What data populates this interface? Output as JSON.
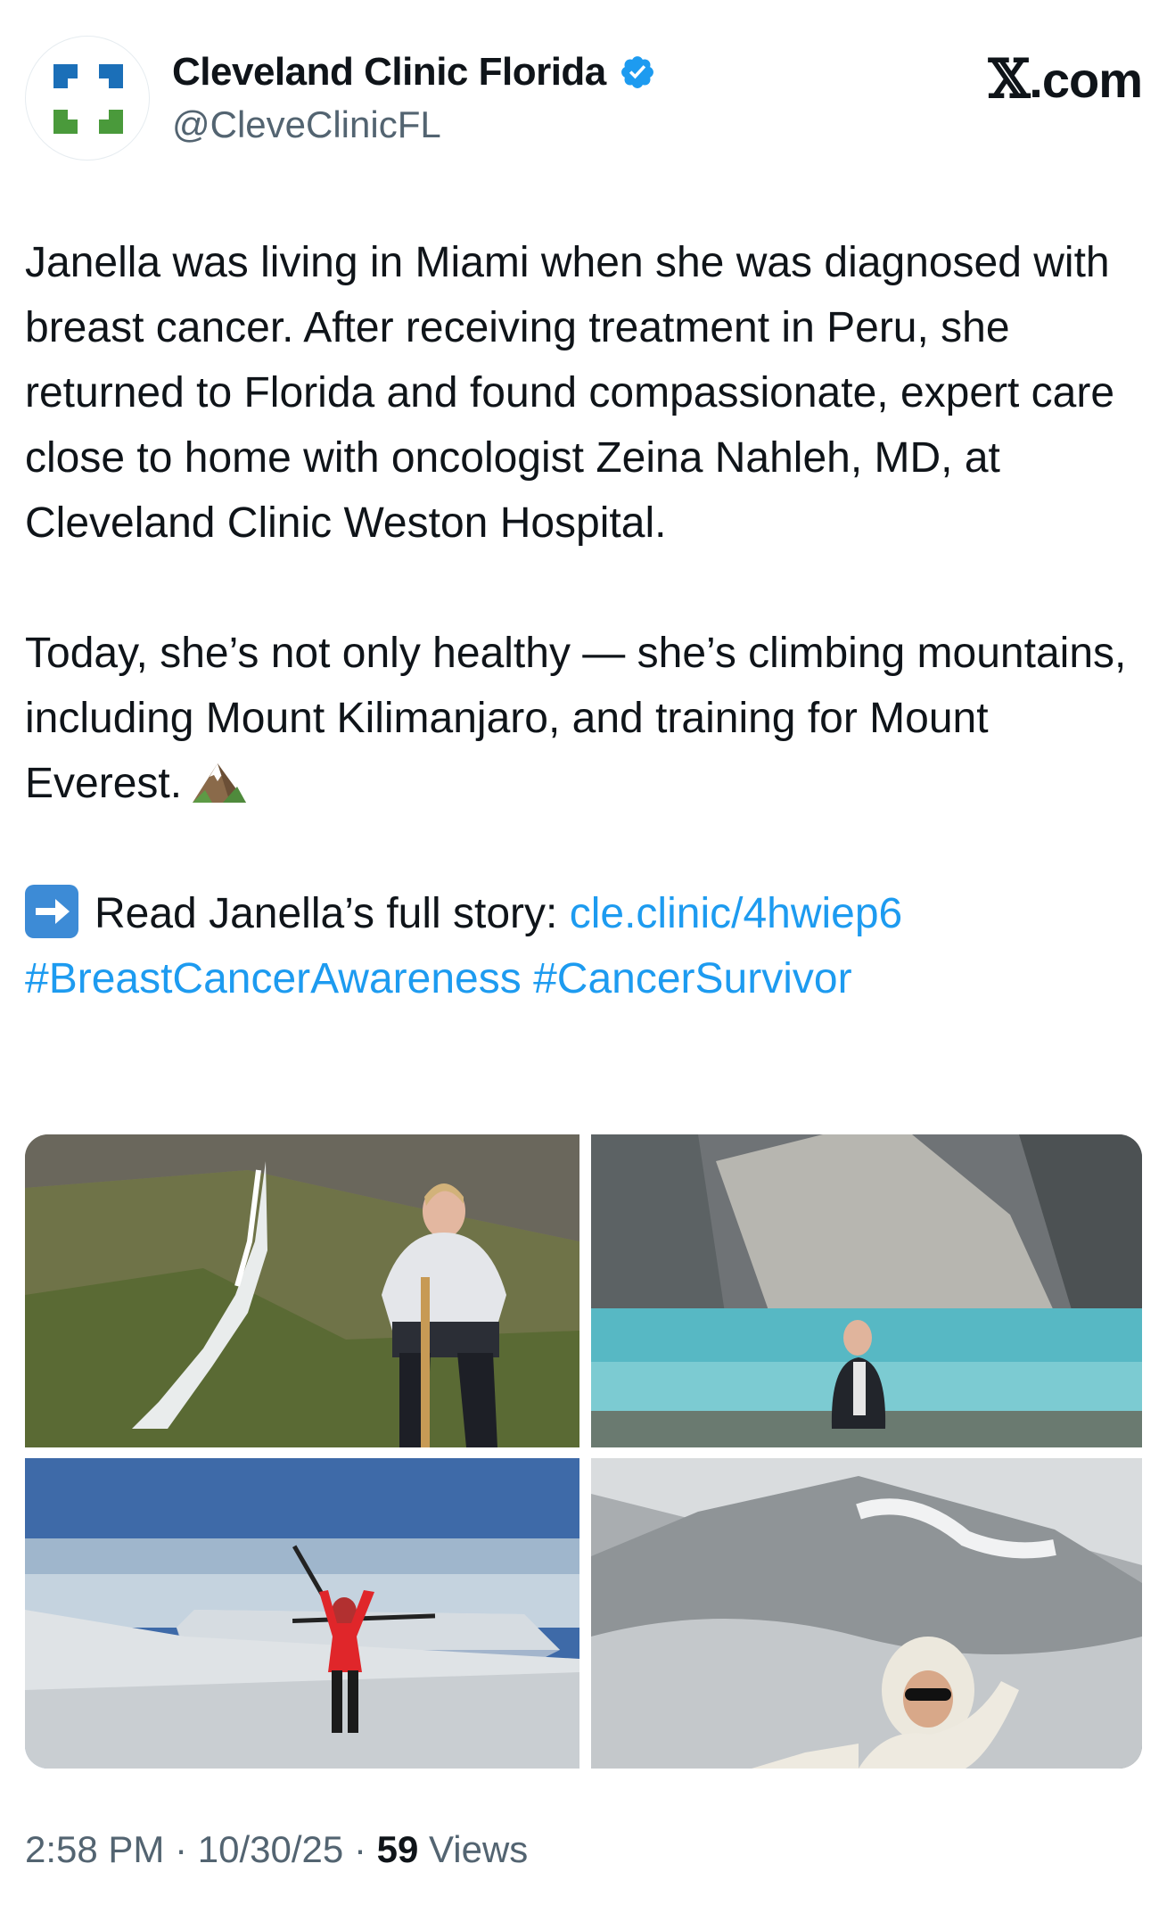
{
  "account": {
    "display_name": "Cleveland Clinic Florida",
    "handle": "@CleveClinicFL",
    "verified": true,
    "avatar_icon": "cleveland-clinic-logo-icon",
    "verified_icon": "verified-badge-icon"
  },
  "site_logo": {
    "mark": "𝕏",
    "text": ".com"
  },
  "tweet": {
    "paragraph1": "Janella was living in Miami when she was diagnosed with breast cancer. After receiving treatment in Peru, she returned to Florida and found compassionate, expert care close to home with oncologist Zeina Nahleh, MD, at Cleveland Clinic Weston Hospital.",
    "paragraph2": "Today, she’s not only healthy — she’s climbing mountains, including Mount Kilimanjaro, and training for Mount Everest.",
    "paragraph2_emoji": "snow-capped-mountain-emoji",
    "cta_emoji": "right-arrow-emoji",
    "cta_text": "Read Janella’s full story:",
    "link": "cle.clinic/4hwiep6",
    "hashtag1": "#BreastCancerAwareness",
    "hashtag2": "#CancerSurvivor"
  },
  "meta": {
    "time": "2:58 PM",
    "sep1": "·",
    "date": "10/30/25",
    "sep2": "·",
    "views_count": "59",
    "views_label": "Views"
  },
  "colors": {
    "link": "#1d9bf0",
    "secondary_text": "#536471",
    "primary_text": "#0f1419",
    "verified_badge": "#1d9bf0",
    "logo_blue": "#1b6fb8",
    "logo_green": "#4a9a3b"
  }
}
